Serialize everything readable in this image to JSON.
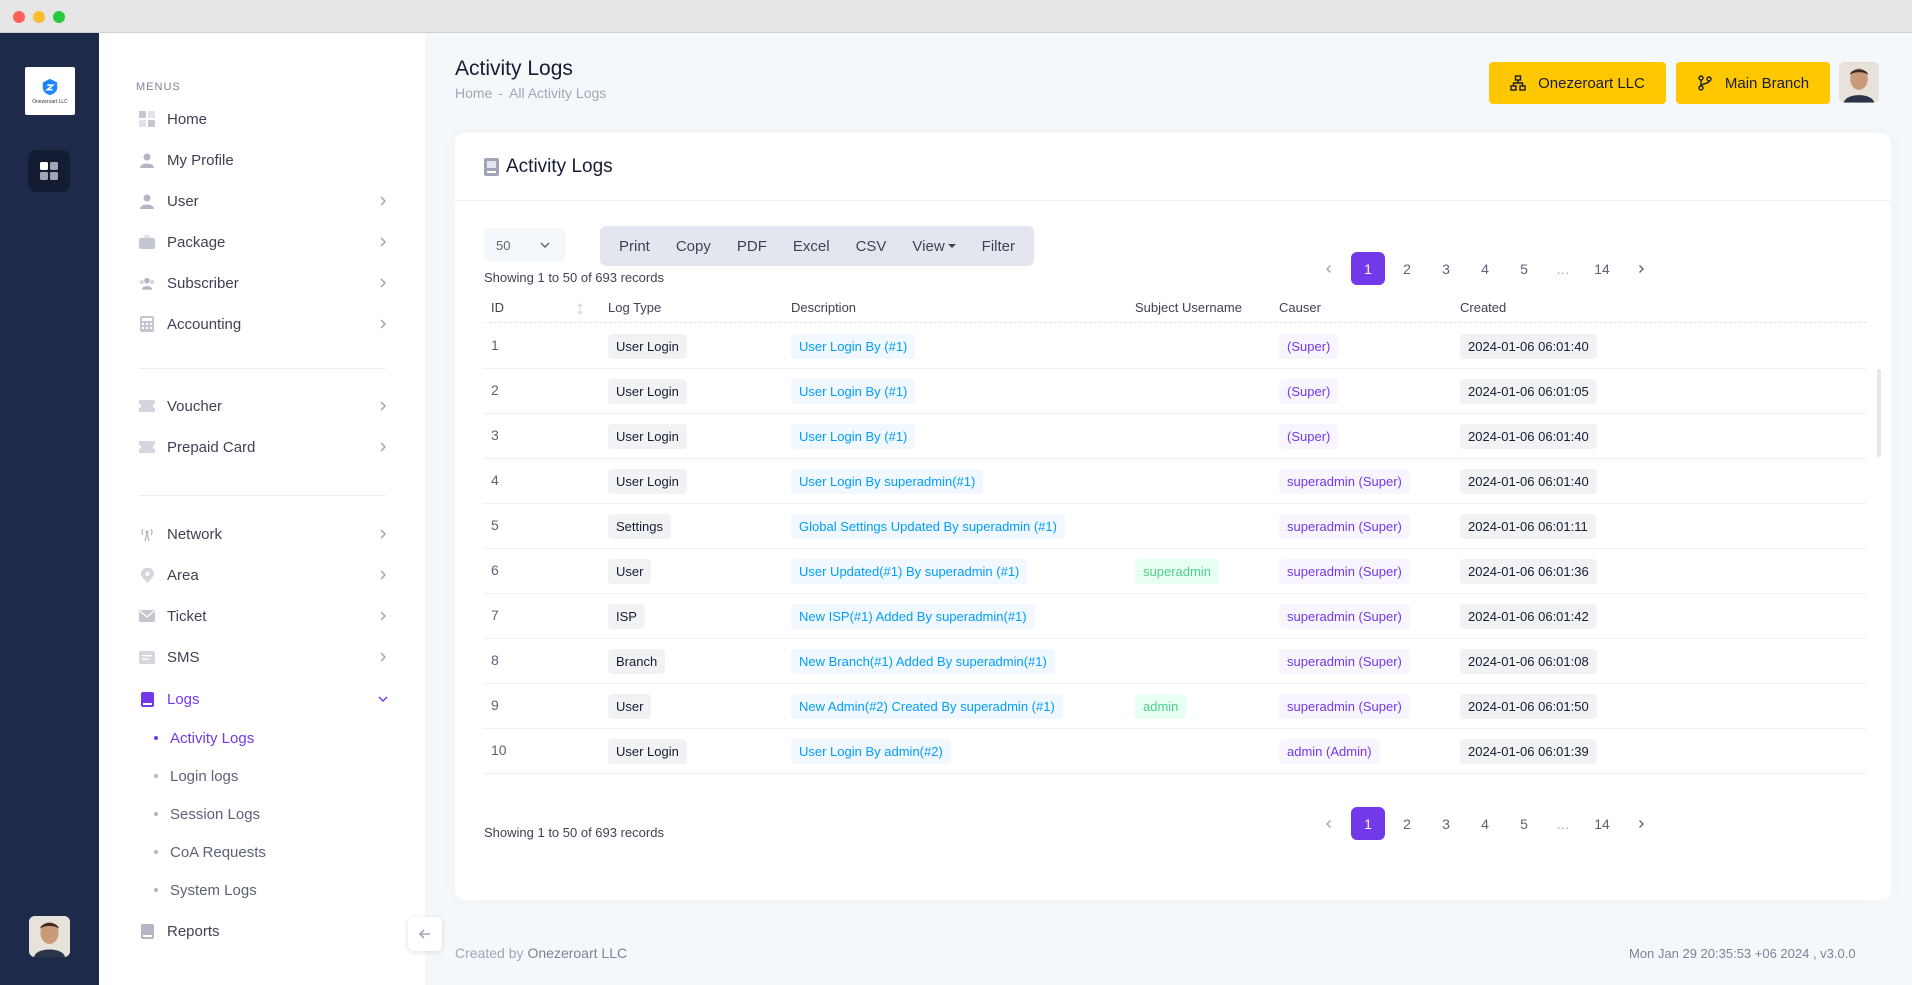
{
  "brand": {
    "name": "Onezeroart LLC"
  },
  "sidebar": {
    "section_label": "MENUS",
    "items": [
      {
        "label": "Home"
      },
      {
        "label": "My Profile"
      },
      {
        "label": "User"
      },
      {
        "label": "Package"
      },
      {
        "label": "Subscriber"
      },
      {
        "label": "Accounting"
      },
      {
        "label": "Voucher"
      },
      {
        "label": "Prepaid Card"
      },
      {
        "label": "Network"
      },
      {
        "label": "Area"
      },
      {
        "label": "Ticket"
      },
      {
        "label": "SMS"
      },
      {
        "label": "Logs"
      },
      {
        "label": "Reports"
      }
    ],
    "logs_subitems": [
      {
        "label": "Activity Logs"
      },
      {
        "label": "Login logs"
      },
      {
        "label": "Session Logs"
      },
      {
        "label": "CoA Requests"
      },
      {
        "label": "System Logs"
      }
    ]
  },
  "header": {
    "title": "Activity Logs",
    "breadcrumb": [
      "Home",
      "-",
      "All Activity Logs"
    ],
    "company_button": "Onezeroart LLC",
    "branch_button": "Main Branch"
  },
  "card": {
    "title": "Activity Logs",
    "page_length": "50",
    "buttons": [
      "Print",
      "Copy",
      "PDF",
      "Excel",
      "CSV",
      "View",
      "Filter"
    ],
    "info": "Showing 1 to 50 of 693 records",
    "pages": [
      "1",
      "2",
      "3",
      "4",
      "5",
      "…",
      "14"
    ],
    "columns": [
      "ID",
      "Log Type",
      "Description",
      "Subject Username",
      "Causer",
      "Created"
    ],
    "rows": [
      {
        "id": "1",
        "type": "User Login",
        "desc": "User Login By (#1)",
        "subject": "",
        "causer": "(Super)",
        "created": "2024-01-06 06:01:40"
      },
      {
        "id": "2",
        "type": "User Login",
        "desc": "User Login By (#1)",
        "subject": "",
        "causer": "(Super)",
        "created": "2024-01-06 06:01:05"
      },
      {
        "id": "3",
        "type": "User Login",
        "desc": "User Login By (#1)",
        "subject": "",
        "causer": "(Super)",
        "created": "2024-01-06 06:01:40"
      },
      {
        "id": "4",
        "type": "User Login",
        "desc": "User Login By superadmin(#1)",
        "subject": "",
        "causer": "superadmin (Super)",
        "created": "2024-01-06 06:01:40"
      },
      {
        "id": "5",
        "type": "Settings",
        "desc": "Global Settings Updated By superadmin (#1)",
        "subject": "",
        "causer": "superadmin (Super)",
        "created": "2024-01-06 06:01:11"
      },
      {
        "id": "6",
        "type": "User",
        "desc": "User Updated(#1) By superadmin (#1)",
        "subject": "superadmin",
        "causer": "superadmin (Super)",
        "created": "2024-01-06 06:01:36"
      },
      {
        "id": "7",
        "type": "ISP",
        "desc": "New ISP(#1) Added By superadmin(#1)",
        "subject": "",
        "causer": "superadmin (Super)",
        "created": "2024-01-06 06:01:42"
      },
      {
        "id": "8",
        "type": "Branch",
        "desc": "New Branch(#1) Added By superadmin(#1)",
        "subject": "",
        "causer": "superadmin (Super)",
        "created": "2024-01-06 06:01:08"
      },
      {
        "id": "9",
        "type": "User",
        "desc": "New Admin(#2) Created By superadmin (#1)",
        "subject": "admin",
        "causer": "superadmin (Super)",
        "created": "2024-01-06 06:01:50"
      },
      {
        "id": "10",
        "type": "User Login",
        "desc": "User Login By admin(#2)",
        "subject": "",
        "causer": "admin (Admin)",
        "created": "2024-01-06 06:01:39"
      }
    ]
  },
  "footer": {
    "created_by": "Created by",
    "company": "Onezeroart LLC",
    "datetime_version": "Mon Jan 29 20:35:53 +06 2024 ,   v3.0.0"
  },
  "colors": {
    "primary": "#7239ea",
    "warning": "#ffc700",
    "info": "#009ef7",
    "success": "#50cd89",
    "sidebar_dark": "#1e2a4a"
  }
}
